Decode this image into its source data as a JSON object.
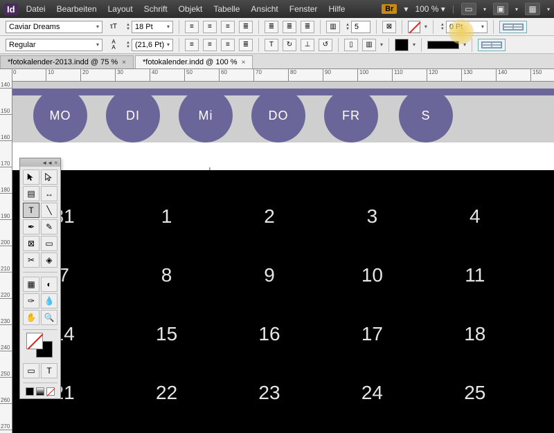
{
  "menubar": {
    "logo": "Id",
    "items": [
      "Datei",
      "Bearbeiten",
      "Layout",
      "Schrift",
      "Objekt",
      "Tabelle",
      "Ansicht",
      "Fenster",
      "Hilfe"
    ],
    "bridge": "Br",
    "zoom": "100 %"
  },
  "controls": {
    "font": "Caviar Dreams",
    "weight": "Regular",
    "size": "18 Pt",
    "leading": "(21,6 Pt)",
    "cols": "5",
    "stroke": "0 Pt"
  },
  "tabs": [
    {
      "label": "*fotokalender-2013.indd @ 75 %",
      "active": false
    },
    {
      "label": "*fotokalender.indd @ 100 %",
      "active": true
    }
  ],
  "ruler_h": [
    "0",
    "10",
    "20",
    "30",
    "40",
    "50",
    "60",
    "70",
    "80",
    "90",
    "100",
    "110",
    "120",
    "130",
    "140",
    "150"
  ],
  "ruler_v": [
    "140",
    "150",
    "160",
    "170",
    "180",
    "190",
    "200",
    "210",
    "220",
    "230",
    "240",
    "250",
    "260",
    "270"
  ],
  "days": [
    "MO",
    "DI",
    "Mi",
    "DO",
    "FR",
    "S"
  ],
  "calendar": [
    [
      "31",
      "1",
      "2",
      "3",
      "4",
      ""
    ],
    [
      "7",
      "8",
      "9",
      "10",
      "11",
      ""
    ],
    [
      "14",
      "15",
      "16",
      "17",
      "18",
      ""
    ],
    [
      "21",
      "22",
      "23",
      "24",
      "25",
      ""
    ]
  ]
}
